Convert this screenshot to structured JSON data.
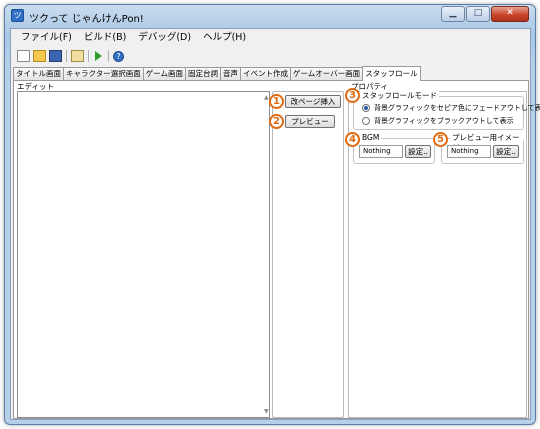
{
  "window": {
    "title": "ツクって じゃんけんPon!"
  },
  "menubar": {
    "items": [
      "ファイル(F)",
      "ビルド(B)",
      "デバッグ(D)",
      "ヘルプ(H)"
    ]
  },
  "toolbar": {
    "icons": [
      "new-file-icon",
      "open-folder-icon",
      "save-icon",
      "copy-icon",
      "run-icon",
      "help-icon"
    ]
  },
  "tabs": [
    "タイトル画面",
    "キャラクター選択画面",
    "ゲーム画面",
    "固定台詞",
    "音声",
    "イベント作成",
    "ゲームオーバー画面",
    "スタッフロール"
  ],
  "active_tab": "スタッフロール",
  "editor": {
    "label": "エディット",
    "content": ""
  },
  "buttons": {
    "page_break": "改ページ挿入",
    "preview": "プレビュー"
  },
  "properties": {
    "label": "プロパティ",
    "mode_group": {
      "title": "スタッフロールモード",
      "options": [
        "背景グラフィックをセピア色にフェードアウトして表示",
        "背景グラフィックをブラックアウトして表示"
      ],
      "selected": 0
    },
    "bgm": {
      "title": "BGM",
      "value": "Nothing",
      "button": "設定.."
    },
    "preview_image": {
      "title": "プレビュー用イメージ",
      "value": "Nothing",
      "button": "設定.."
    }
  },
  "markers": [
    "1",
    "2",
    "3",
    "4",
    "5"
  ],
  "colors": {
    "marker": "#e06a10",
    "accent": "#2b5aa8"
  }
}
